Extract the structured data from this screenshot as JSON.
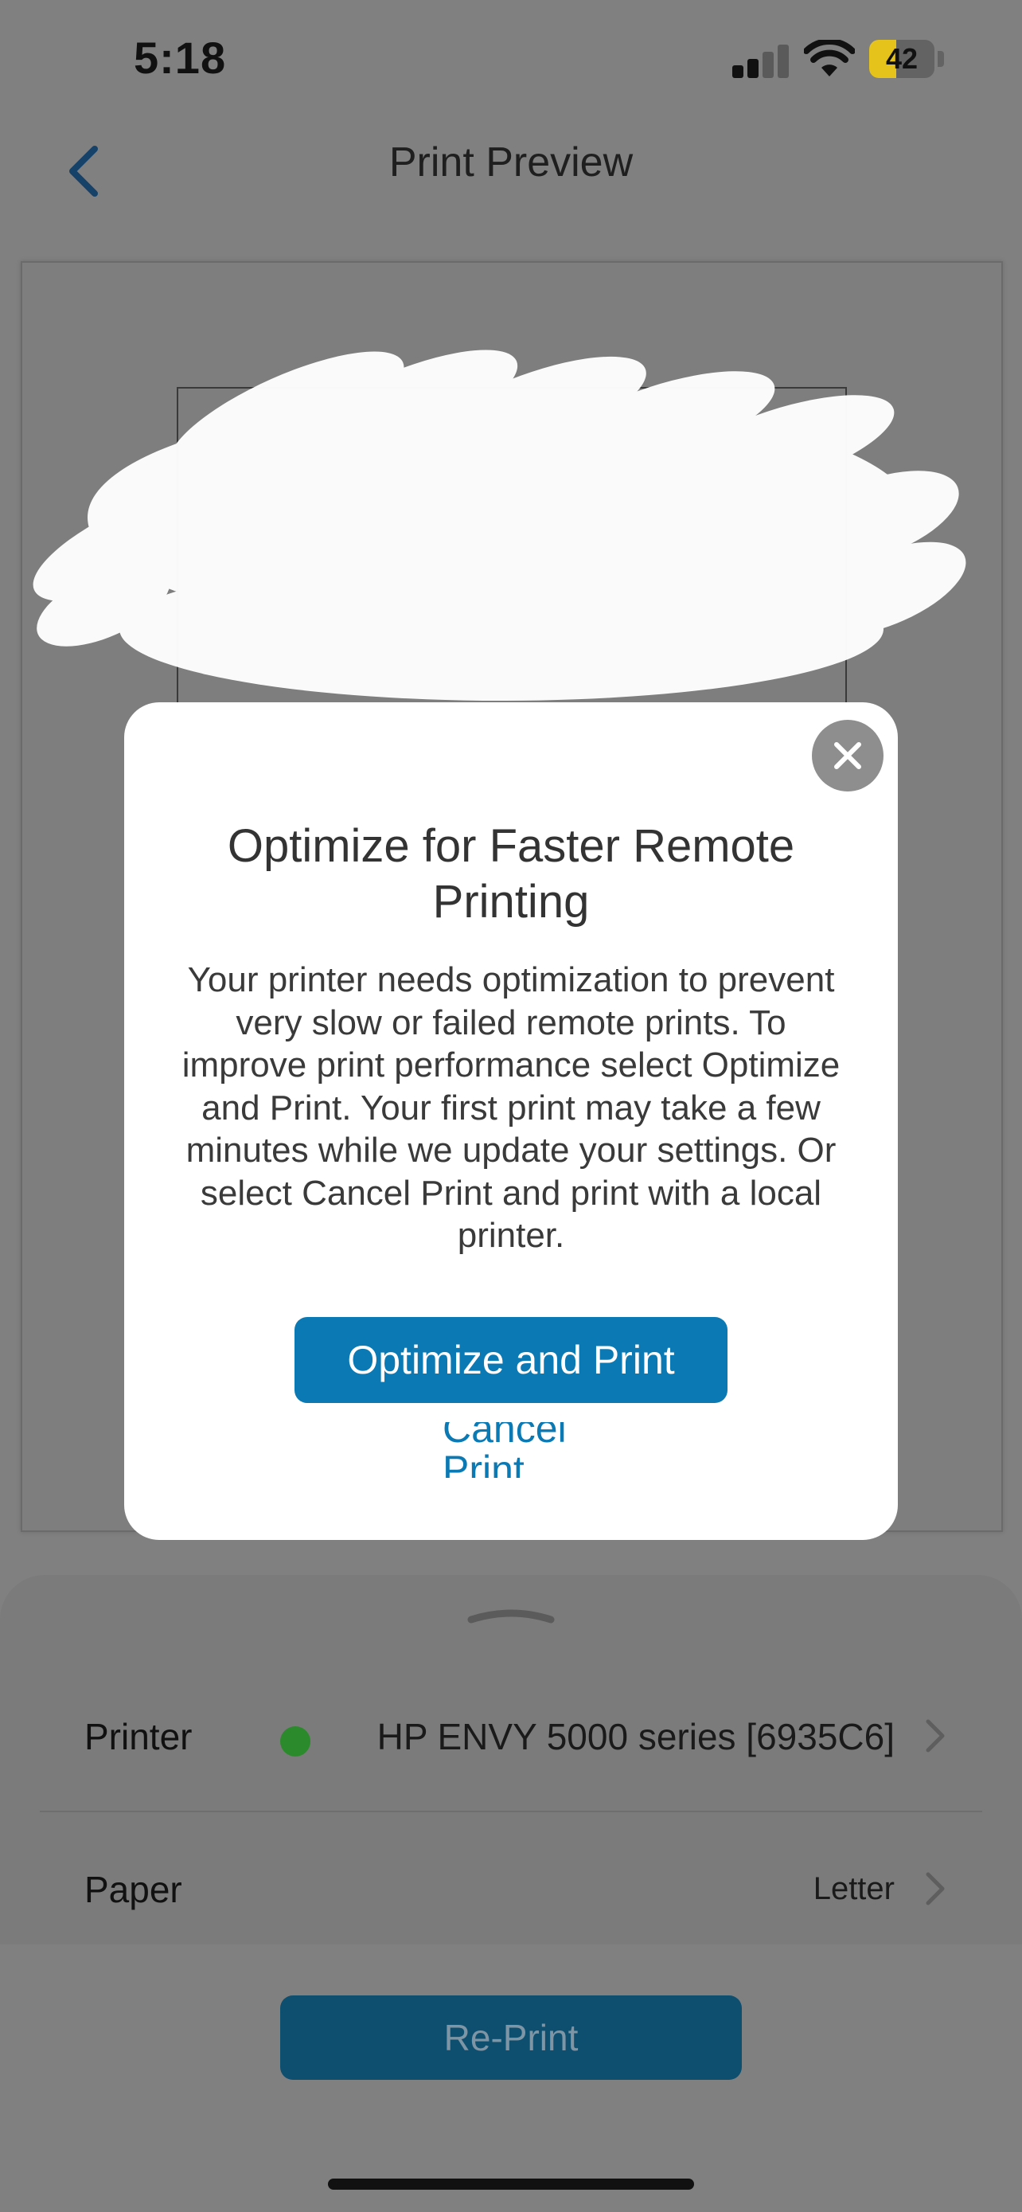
{
  "status_bar": {
    "time": "5:18",
    "battery_level": "42",
    "battery_fraction": 0.42,
    "icons": [
      "signal-icon",
      "wifi-icon",
      "battery-icon"
    ]
  },
  "header": {
    "title": "Print Preview",
    "back_icon": "chevron-left-icon"
  },
  "modal": {
    "title": "Optimize for Faster Remote Printing",
    "body": "Your printer needs optimization to prevent very slow or failed remote prints. To improve print performance select Optimize and Print. Your first print may take a few minutes while we update your settings. Or select Cancel Print and print with a local printer.",
    "primary_button": "Optimize and Print",
    "cancel_line_1": "Cancel",
    "cancel_line_2": "Print",
    "close_icon": "close-icon"
  },
  "settings": {
    "printer": {
      "label": "Printer",
      "value": "HP ENVY 5000 series [6935C6]",
      "status_color": "#2b8a2b"
    },
    "paper": {
      "label": "Paper",
      "value": "Letter"
    }
  },
  "footer": {
    "reprint_button": "Re-Print"
  },
  "colors": {
    "accent": "#0b79b3",
    "dim_overlay": "#808080",
    "battery_yellow": "#e6c31a"
  }
}
